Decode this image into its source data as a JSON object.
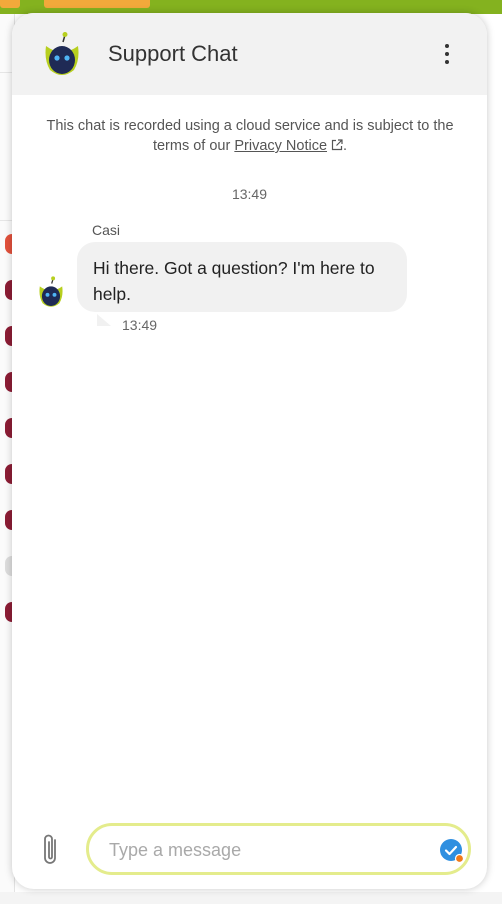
{
  "header": {
    "title": "Support Chat",
    "avatar_icon": "robot-avatar-icon",
    "menu_icon": "more-vertical-icon"
  },
  "disclaimer": {
    "text_before": "This chat is recorded using a cloud service and is subject to the terms of our ",
    "link_text": "Privacy Notice",
    "text_after": "."
  },
  "conversation": {
    "date_time": "13:49",
    "messages": [
      {
        "sender": "Casi",
        "text": "Hi there. Got a question? I'm here to help.",
        "time": "13:49"
      }
    ]
  },
  "composer": {
    "placeholder": "Type a message",
    "value": "",
    "attach_icon": "paperclip-icon",
    "send_icon": "send-icon"
  },
  "colors": {
    "header_bg": "#f2f2f2",
    "input_border": "#e4ec8c",
    "send_blue": "#2f8fe0",
    "notify_orange": "#f07a1a",
    "bg_green": "#84b21f"
  }
}
